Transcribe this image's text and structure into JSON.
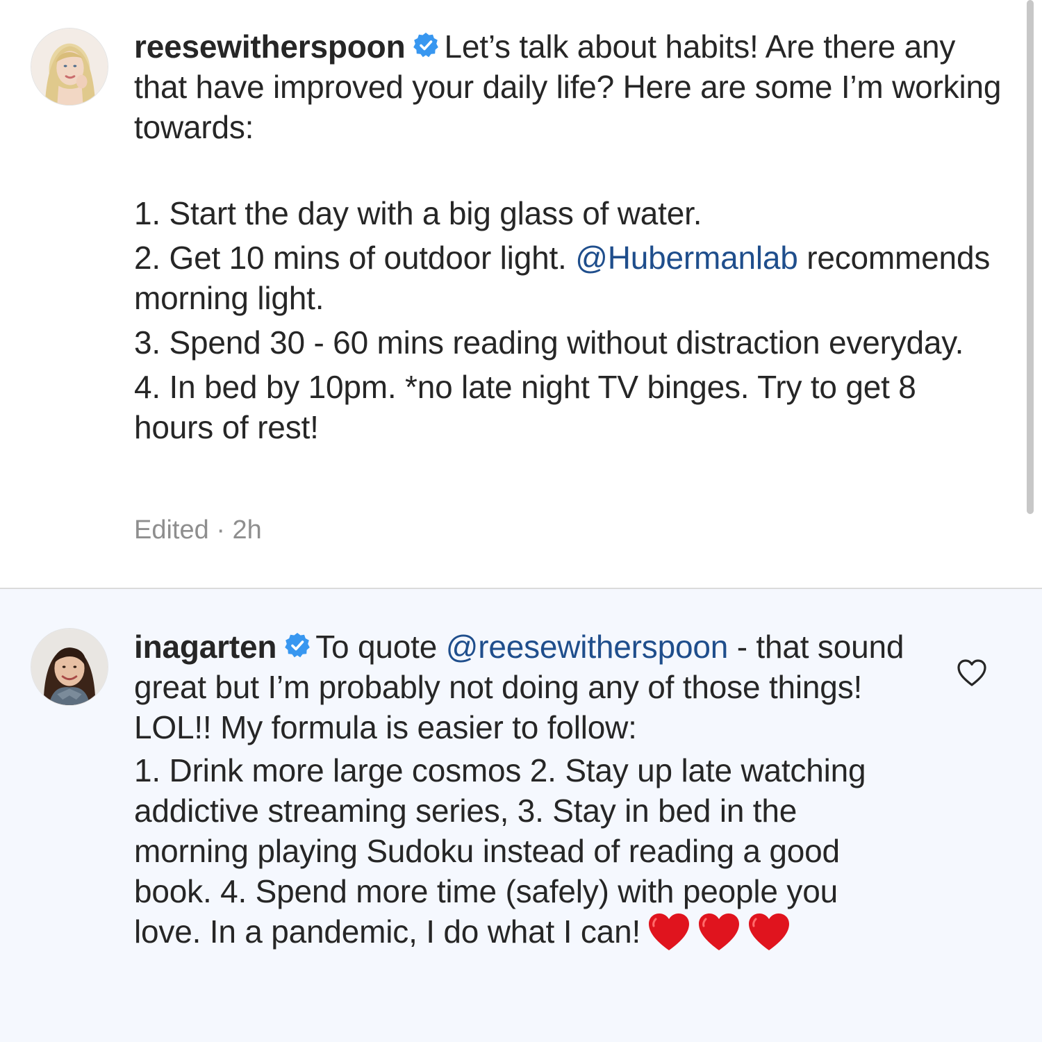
{
  "post": {
    "author": {
      "username": "reesewitherspoon",
      "verified": true,
      "avatar": "reese-avatar"
    },
    "caption": {
      "intro": "Let’s talk about habits! Are there any that have improved your daily life? Here are some I’m working towards:",
      "item1": "1. Start the day with a big glass of water.",
      "item2_prefix": "2. Get 10 mins of outdoor light. ",
      "item2_mention": "@Hubermanlab",
      "item2_suffix": " recommends morning light.",
      "item3": "3. Spend 30 - 60 mins reading without distraction everyday.",
      "item4": "4. In bed by 10pm. *no late night TV binges. Try to get  8 hours of rest!"
    },
    "meta": {
      "edited": "Edited",
      "separator": "·",
      "time": "2h"
    }
  },
  "comment": {
    "author": {
      "username": "inagarten",
      "verified": true,
      "avatar": "ina-avatar"
    },
    "text_prefix": "To quote ",
    "mention": "@reesewitherspoon",
    "text_body": " - that sound great but I’m probably not doing any of those things!  LOL!! My formula is easier to follow:",
    "list": "1. Drink more large cosmos  2.  Stay up late watching addictive streaming series,  3.  Stay in bed in the morning playing Sudoku instead of reading a good book.  4.  Spend more time (safely) with people you love.  In a pandemic, I do what I can!",
    "emoji": [
      "red-heart-emoji",
      "red-heart-emoji",
      "red-heart-emoji"
    ],
    "like_icon": "heart-outline-icon"
  },
  "colors": {
    "mention": "#1f4e8c",
    "verified_badge": "#3897f0",
    "meta_text": "#8e8e8e",
    "comment_background": "#f5f8fe",
    "divider": "#dbdbdb"
  }
}
